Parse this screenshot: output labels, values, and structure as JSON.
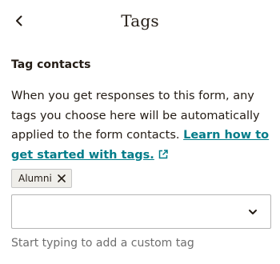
{
  "header": {
    "title": "Tags",
    "back_icon": "chevron-left-icon"
  },
  "section": {
    "title": "Tag contacts",
    "description": "When you get responses to this form, any tags you choose here will be automatically applied to the form contacts.",
    "link_text": "Learn how to get started with tags.",
    "link_icon": "external-link-icon"
  },
  "tags": [
    {
      "label": "Alumni",
      "remove_icon": "close-icon"
    }
  ],
  "select": {
    "value": "",
    "dropdown_icon": "chevron-down-icon"
  },
  "help_text": "Start typing to add a custom tag",
  "colors": {
    "text": "#241c15",
    "link": "#007c89",
    "chip_background": "#efeeea",
    "muted_text": "#6e6e6e"
  }
}
